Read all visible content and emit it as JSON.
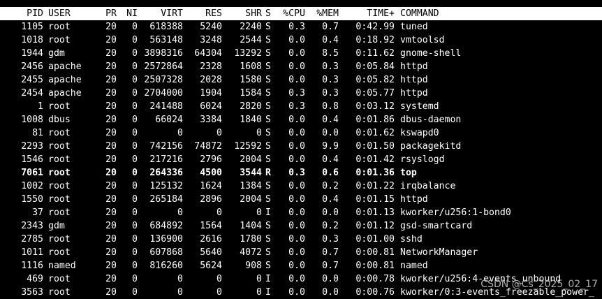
{
  "header": {
    "pid": "PID",
    "user": "USER",
    "pr": "PR",
    "ni": "NI",
    "virt": "VIRT",
    "res": "RES",
    "shr": "SHR",
    "s": "S",
    "cpu": "%CPU",
    "mem": "%MEM",
    "time": "TIME+",
    "command": "COMMAND"
  },
  "processes": [
    {
      "pid": "1105",
      "user": "root",
      "pr": "20",
      "ni": "0",
      "virt": "618388",
      "res": "5240",
      "shr": "2240",
      "s": "S",
      "cpu": "0.3",
      "mem": "0.7",
      "time": "0:42.99",
      "command": "tuned"
    },
    {
      "pid": "1018",
      "user": "root",
      "pr": "20",
      "ni": "0",
      "virt": "563148",
      "res": "3248",
      "shr": "2544",
      "s": "S",
      "cpu": "0.0",
      "mem": "0.4",
      "time": "0:18.92",
      "command": "vmtoolsd"
    },
    {
      "pid": "1944",
      "user": "gdm",
      "pr": "20",
      "ni": "0",
      "virt": "3898316",
      "res": "64304",
      "shr": "13292",
      "s": "S",
      "cpu": "0.0",
      "mem": "8.5",
      "time": "0:11.62",
      "command": "gnome-shell"
    },
    {
      "pid": "2456",
      "user": "apache",
      "pr": "20",
      "ni": "0",
      "virt": "2572864",
      "res": "2328",
      "shr": "1608",
      "s": "S",
      "cpu": "0.0",
      "mem": "0.3",
      "time": "0:05.84",
      "command": "httpd"
    },
    {
      "pid": "2455",
      "user": "apache",
      "pr": "20",
      "ni": "0",
      "virt": "2507328",
      "res": "2028",
      "shr": "1580",
      "s": "S",
      "cpu": "0.0",
      "mem": "0.3",
      "time": "0:05.82",
      "command": "httpd"
    },
    {
      "pid": "2454",
      "user": "apache",
      "pr": "20",
      "ni": "0",
      "virt": "2704000",
      "res": "1904",
      "shr": "1584",
      "s": "S",
      "cpu": "0.3",
      "mem": "0.3",
      "time": "0:05.77",
      "command": "httpd"
    },
    {
      "pid": "1",
      "user": "root",
      "pr": "20",
      "ni": "0",
      "virt": "241488",
      "res": "6024",
      "shr": "2820",
      "s": "S",
      "cpu": "0.3",
      "mem": "0.8",
      "time": "0:03.12",
      "command": "systemd"
    },
    {
      "pid": "1008",
      "user": "dbus",
      "pr": "20",
      "ni": "0",
      "virt": "66024",
      "res": "3384",
      "shr": "1840",
      "s": "S",
      "cpu": "0.0",
      "mem": "0.4",
      "time": "0:01.86",
      "command": "dbus-daemon"
    },
    {
      "pid": "81",
      "user": "root",
      "pr": "20",
      "ni": "0",
      "virt": "0",
      "res": "0",
      "shr": "0",
      "s": "S",
      "cpu": "0.0",
      "mem": "0.0",
      "time": "0:01.62",
      "command": "kswapd0"
    },
    {
      "pid": "2293",
      "user": "root",
      "pr": "20",
      "ni": "0",
      "virt": "742156",
      "res": "74872",
      "shr": "12592",
      "s": "S",
      "cpu": "0.0",
      "mem": "9.9",
      "time": "0:01.50",
      "command": "packagekitd"
    },
    {
      "pid": "1546",
      "user": "root",
      "pr": "20",
      "ni": "0",
      "virt": "217216",
      "res": "2796",
      "shr": "2004",
      "s": "S",
      "cpu": "0.0",
      "mem": "0.4",
      "time": "0:01.42",
      "command": "rsyslogd"
    },
    {
      "pid": "7061",
      "user": "root",
      "pr": "20",
      "ni": "0",
      "virt": "264336",
      "res": "4500",
      "shr": "3544",
      "s": "R",
      "cpu": "0.3",
      "mem": "0.6",
      "time": "0:01.36",
      "command": "top",
      "bold": true
    },
    {
      "pid": "1002",
      "user": "root",
      "pr": "20",
      "ni": "0",
      "virt": "125132",
      "res": "1624",
      "shr": "1384",
      "s": "S",
      "cpu": "0.0",
      "mem": "0.2",
      "time": "0:01.22",
      "command": "irqbalance"
    },
    {
      "pid": "1550",
      "user": "root",
      "pr": "20",
      "ni": "0",
      "virt": "265184",
      "res": "2896",
      "shr": "2004",
      "s": "S",
      "cpu": "0.0",
      "mem": "0.4",
      "time": "0:01.15",
      "command": "httpd"
    },
    {
      "pid": "37",
      "user": "root",
      "pr": "20",
      "ni": "0",
      "virt": "0",
      "res": "0",
      "shr": "0",
      "s": "I",
      "cpu": "0.0",
      "mem": "0.0",
      "time": "0:01.13",
      "command": "kworker/u256:1-bond0"
    },
    {
      "pid": "2343",
      "user": "gdm",
      "pr": "20",
      "ni": "0",
      "virt": "684892",
      "res": "1564",
      "shr": "1404",
      "s": "S",
      "cpu": "0.0",
      "mem": "0.2",
      "time": "0:01.12",
      "command": "gsd-smartcard"
    },
    {
      "pid": "2785",
      "user": "root",
      "pr": "20",
      "ni": "0",
      "virt": "136900",
      "res": "2616",
      "shr": "1780",
      "s": "S",
      "cpu": "0.0",
      "mem": "0.3",
      "time": "0:01.00",
      "command": "sshd"
    },
    {
      "pid": "1011",
      "user": "root",
      "pr": "20",
      "ni": "0",
      "virt": "607868",
      "res": "5640",
      "shr": "4072",
      "s": "S",
      "cpu": "0.0",
      "mem": "0.7",
      "time": "0:00.81",
      "command": "NetworkManager"
    },
    {
      "pid": "1116",
      "user": "named",
      "pr": "20",
      "ni": "0",
      "virt": "816260",
      "res": "5624",
      "shr": "908",
      "s": "S",
      "cpu": "0.0",
      "mem": "0.7",
      "time": "0:00.81",
      "command": "named"
    },
    {
      "pid": "469",
      "user": "root",
      "pr": "20",
      "ni": "0",
      "virt": "0",
      "res": "0",
      "shr": "0",
      "s": "I",
      "cpu": "0.0",
      "mem": "0.0",
      "time": "0:00.78",
      "command": "kworker/u256:4-events_unbound"
    },
    {
      "pid": "3563",
      "user": "root",
      "pr": "20",
      "ni": "0",
      "virt": "0",
      "res": "0",
      "shr": "0",
      "s": "I",
      "cpu": "0.0",
      "mem": "0.0",
      "time": "0:00.76",
      "command": "kworker/0:3-events_freezable_power_"
    }
  ],
  "watermark": "CSDN @Cs_2025_02_17",
  "colors": {
    "background": "#000000",
    "foreground": "#ffffff",
    "header_background": "#ffffff",
    "header_foreground": "#000000"
  }
}
